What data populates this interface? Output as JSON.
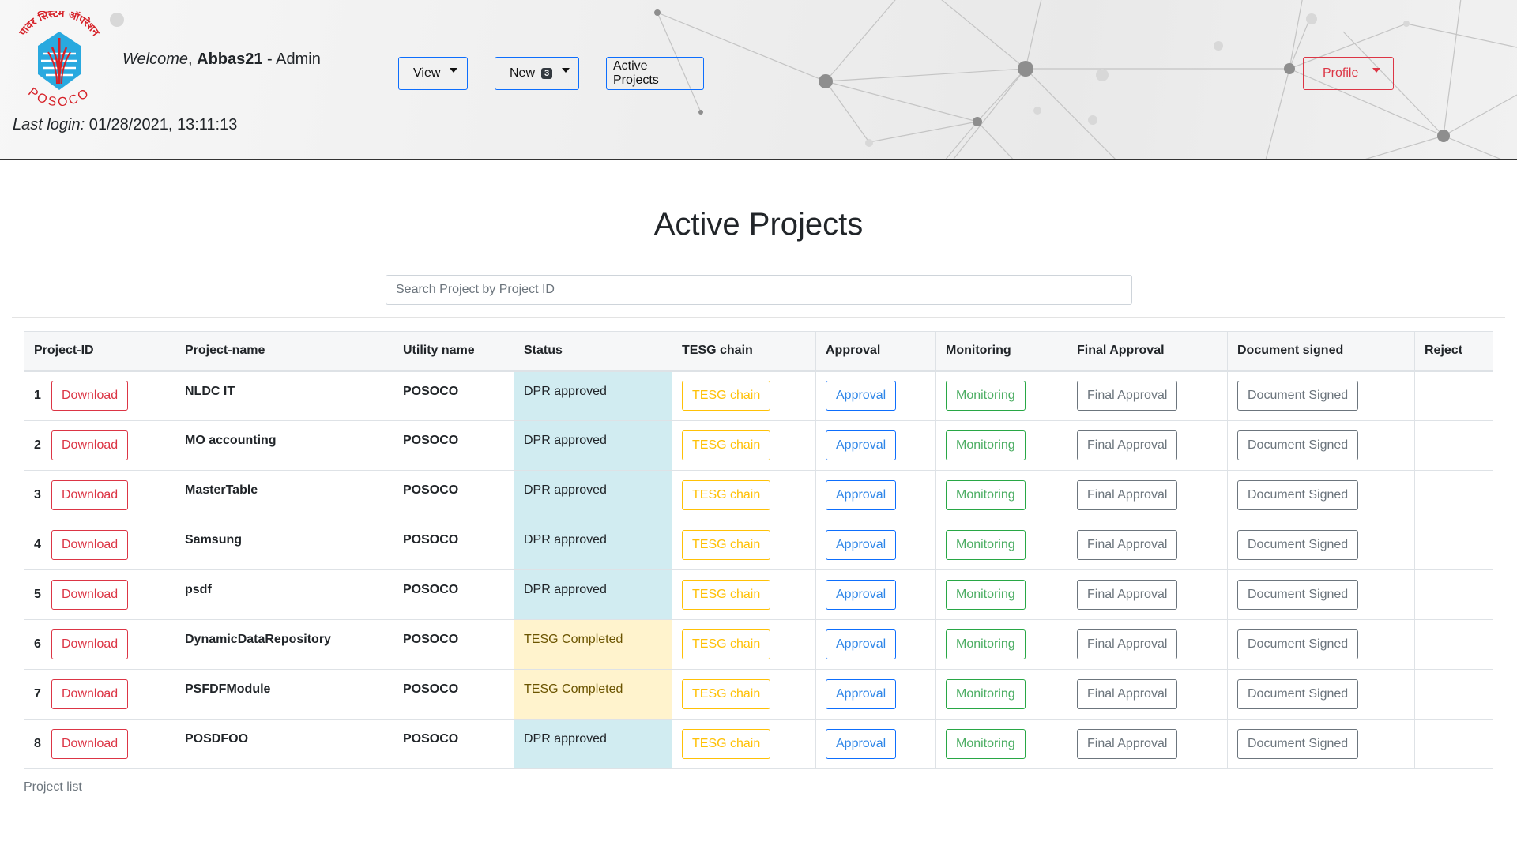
{
  "header": {
    "welcome_label": "Welcome",
    "username": "Abbas21",
    "role": "Admin",
    "last_login_label": "Last login:",
    "last_login_value": "01/28/2021, 13:11:13",
    "logo_text_top": "पावर सिस्टम ऑपरेशन",
    "logo_text_bottom": "POSOCO",
    "nav": {
      "view_label": "View",
      "new_label": "New",
      "new_badge": "3",
      "active_projects_label": "Active Projects",
      "profile_label": "Profile"
    }
  },
  "page": {
    "title": "Active Projects",
    "search_placeholder": "Search Project by Project ID",
    "caption": "Project list"
  },
  "table": {
    "columns": [
      "Project-ID",
      "Project-name",
      "Utility name",
      "Status",
      "TESG chain",
      "Approval",
      "Monitoring",
      "Final Approval",
      "Document signed",
      "Reject"
    ],
    "buttons": {
      "download": "Download",
      "tesg": "TESG chain",
      "approval": "Approval",
      "monitoring": "Monitoring",
      "final": "Final Approval",
      "document": "Document Signed"
    },
    "rows": [
      {
        "id": "1",
        "name": "NLDC IT",
        "utility": "POSOCO",
        "status": "DPR approved",
        "status_kind": "info"
      },
      {
        "id": "2",
        "name": "MO accounting",
        "utility": "POSOCO",
        "status": "DPR approved",
        "status_kind": "info"
      },
      {
        "id": "3",
        "name": "MasterTable",
        "utility": "POSOCO",
        "status": "DPR approved",
        "status_kind": "info"
      },
      {
        "id": "4",
        "name": "Samsung",
        "utility": "POSOCO",
        "status": "DPR approved",
        "status_kind": "info"
      },
      {
        "id": "5",
        "name": "psdf",
        "utility": "POSOCO",
        "status": "DPR approved",
        "status_kind": "info"
      },
      {
        "id": "6",
        "name": "DynamicDataRepository",
        "utility": "POSOCO",
        "status": "TESG Completed",
        "status_kind": "warning"
      },
      {
        "id": "7",
        "name": "PSFDFModule",
        "utility": "POSOCO",
        "status": "TESG Completed",
        "status_kind": "warning"
      },
      {
        "id": "8",
        "name": "POSDFOO",
        "utility": "POSOCO",
        "status": "DPR approved",
        "status_kind": "info"
      }
    ]
  },
  "colors": {
    "danger": "#dc3545",
    "warning": "#ffc107",
    "primary": "#0d6efd",
    "success": "#28a745",
    "secondary": "#6c757d",
    "status_info_bg": "#d1ecf1",
    "status_warning_bg": "#fff3cd",
    "logo_red": "#d62027",
    "logo_blue": "#29a9df"
  }
}
